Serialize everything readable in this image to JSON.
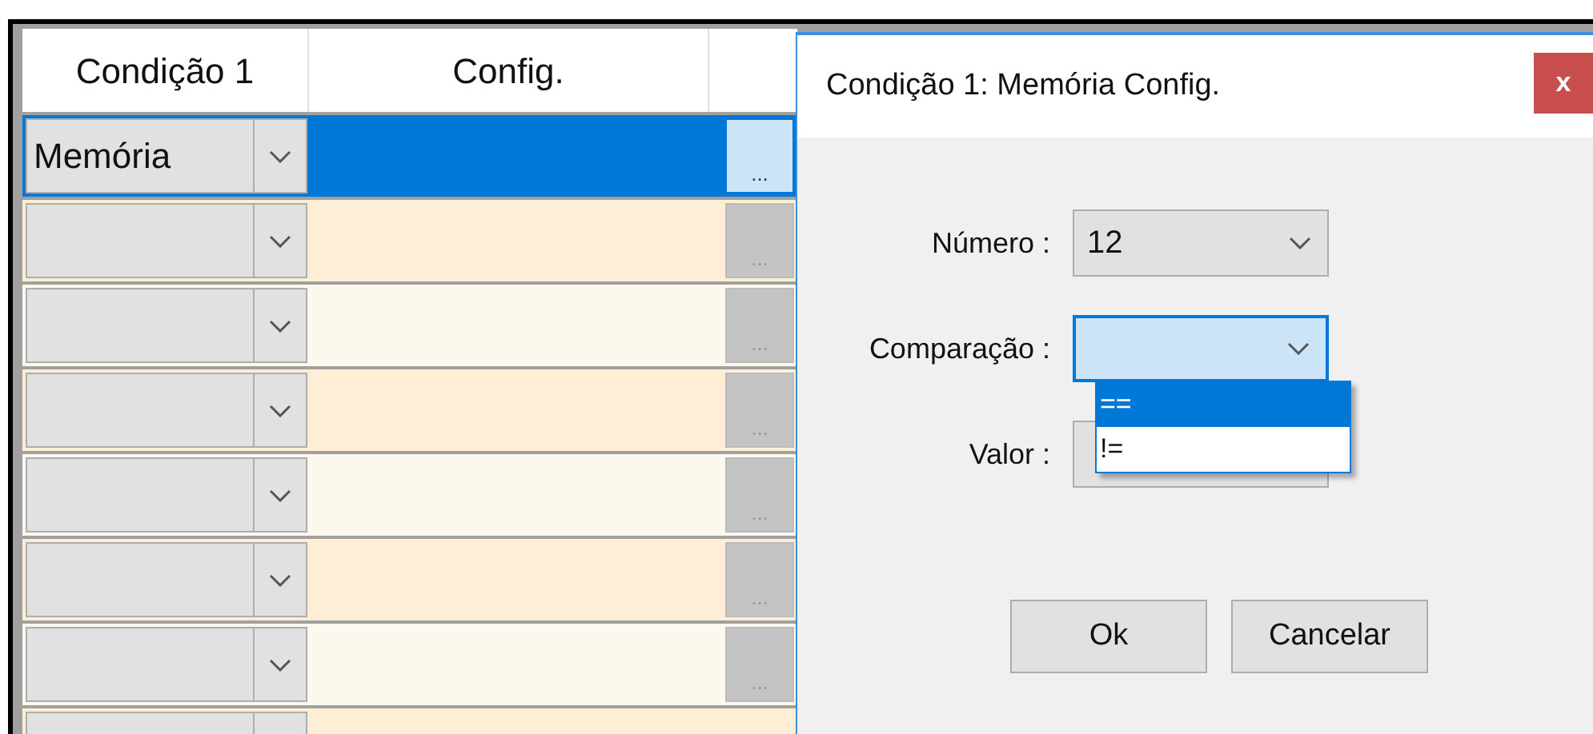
{
  "grid": {
    "columns": [
      {
        "label": "Condição 1"
      },
      {
        "label": "Config."
      }
    ],
    "rows": [
      {
        "condition": "Memória",
        "button": "...",
        "selected": true
      },
      {
        "button": "...",
        "selected": false
      },
      {
        "button": "...",
        "selected": false
      },
      {
        "button": "...",
        "selected": false
      },
      {
        "button": "...",
        "selected": false
      },
      {
        "button": "...",
        "selected": false
      },
      {
        "button": "...",
        "selected": false
      },
      {
        "selected": false
      }
    ]
  },
  "dialog": {
    "title": "Condição 1: Memória Config.",
    "close": "x",
    "fields": [
      {
        "label": "Número :",
        "value": "12",
        "focused": false
      },
      {
        "label": "Comparação :",
        "focused": true,
        "options": [
          {
            "label": "==",
            "selected": true
          },
          {
            "label": "!=",
            "selected": false
          }
        ]
      },
      {
        "label": "Valor :",
        "focused": false
      }
    ],
    "buttons": [
      "Ok",
      "Cancelar"
    ]
  }
}
